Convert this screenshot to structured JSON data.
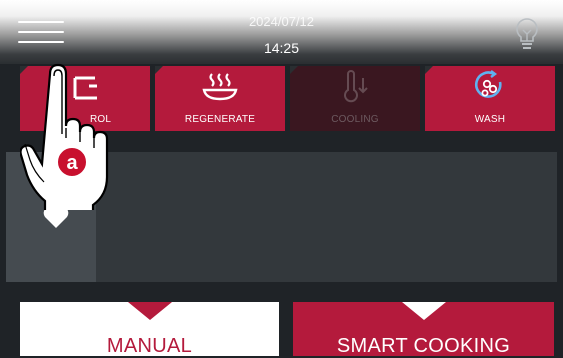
{
  "header": {
    "date": "2024/07/12",
    "time": "14:25",
    "menu_icon": "hamburger-menu-icon",
    "light_icon": "lightbulb-icon"
  },
  "tabs": [
    {
      "label": "CONTROL",
      "visible_label": "ROL",
      "icon": "probe-control-icon",
      "enabled": true
    },
    {
      "label": "REGENERATE",
      "icon": "steam-plate-icon",
      "enabled": true
    },
    {
      "label": "COOLING",
      "icon": "thermometer-down-icon",
      "enabled": false
    },
    {
      "label": "WASH",
      "icon": "wash-drops-icon",
      "enabled": true
    }
  ],
  "favorites": {
    "icon": "heart-icon"
  },
  "cards": {
    "manual": "MANUAL",
    "smart": "SMART COOKING"
  },
  "overlay": {
    "badge": "a",
    "icon": "pointing-hand-icon"
  },
  "colors": {
    "accent": "#b41a3c",
    "background": "#1f2327",
    "panel": "#33383c",
    "tile": "#454b50"
  }
}
